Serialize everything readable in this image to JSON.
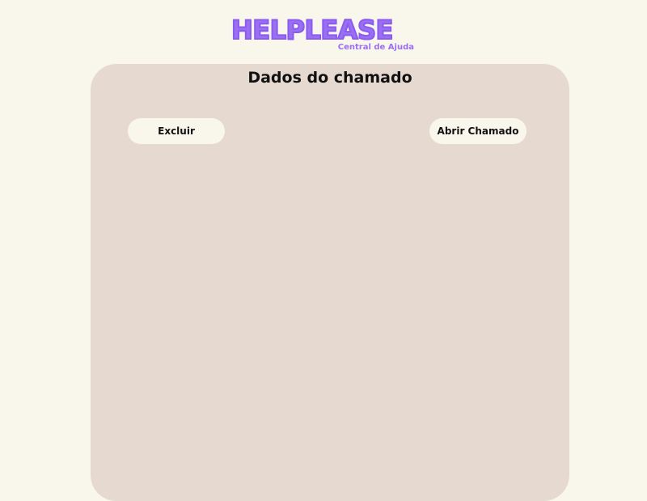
{
  "logo": {
    "title": "HELPLEASE",
    "subtitle": "Central de Ajuda"
  },
  "panel": {
    "title": "Dados do chamado",
    "delete_label": "Excluir",
    "open_ticket_label": "Abrir Chamado"
  },
  "colors": {
    "background": "#f9f6ec",
    "panel": "#e6d9d0",
    "brand": "#9b6ff2"
  }
}
